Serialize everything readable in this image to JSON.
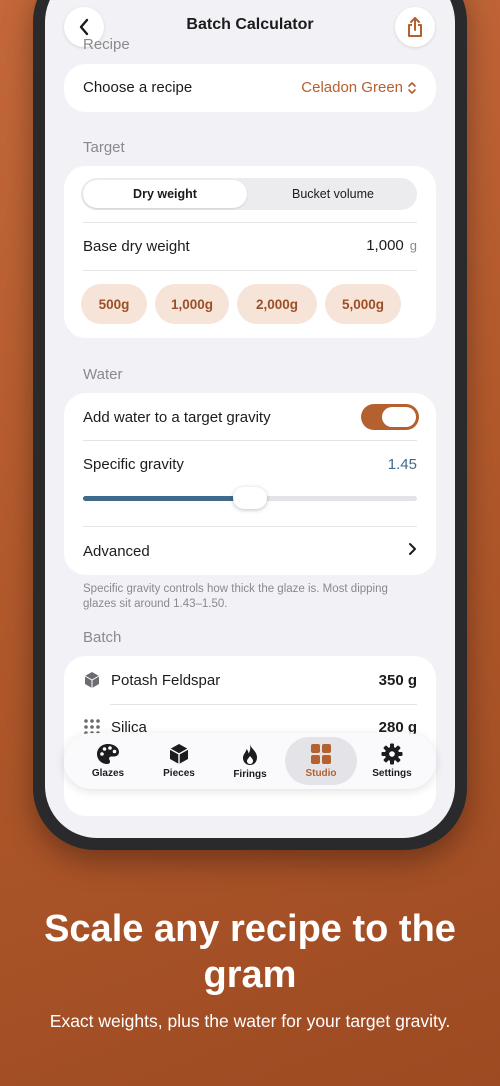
{
  "nav": {
    "title": "Batch Calculator"
  },
  "recipe": {
    "section_label": "Recipe",
    "row_label": "Choose a recipe",
    "selected_value": "Celadon Green"
  },
  "target": {
    "section_label": "Target",
    "segments": [
      "Dry weight",
      "Bucket volume"
    ],
    "selected_segment": "Dry weight",
    "base_label": "Base dry weight",
    "base_value": "1,000",
    "base_unit": "g",
    "presets": [
      "500g",
      "1,000g",
      "2,000g",
      "5,000g"
    ]
  },
  "water": {
    "section_label": "Water",
    "toggle_label": "Add water to a target gravity",
    "toggle_on": true,
    "sg_label": "Specific gravity",
    "sg_value": "1.45",
    "sg_slider_fraction": 0.5,
    "advanced_label": "Advanced",
    "footnote": "Specific gravity controls how thick the glaze is. Most dipping glazes sit around 1.43–1.50."
  },
  "batch": {
    "section_label": "Batch",
    "items": [
      {
        "name": "Potash Feldspar",
        "amount": "350 g",
        "icon": "cube-icon"
      },
      {
        "name": "Silica",
        "amount": "280 g",
        "icon": "dots-grid-icon"
      }
    ]
  },
  "tabs": [
    {
      "label": "Glazes",
      "icon": "palette-icon"
    },
    {
      "label": "Pieces",
      "icon": "cube-icon"
    },
    {
      "label": "Firings",
      "icon": "flame-icon"
    },
    {
      "label": "Studio",
      "icon": "grid-icon",
      "selected": true
    },
    {
      "label": "Settings",
      "icon": "gear-icon"
    }
  ],
  "marketing": {
    "headline": "Scale any recipe to the gram",
    "subhead": "Exact weights, plus the water for your target gravity."
  },
  "colors": {
    "accent": "#b5602f",
    "chip_bg": "#f6e4d8",
    "slider": "#3f6a8a",
    "background": "#f2f2f6"
  }
}
